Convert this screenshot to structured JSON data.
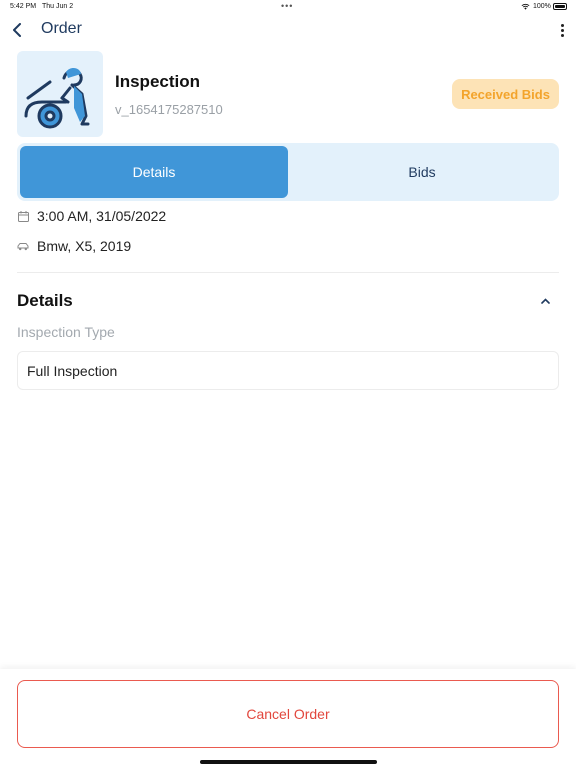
{
  "status_bar": {
    "time": "5:42 PM",
    "date": "Thu Jun 2",
    "battery": "100%"
  },
  "nav": {
    "title": "Order",
    "back_icon": "chevron-left-icon",
    "more_icon": "more-vertical-icon"
  },
  "order": {
    "service_name": "Inspection",
    "order_id": "v_1654175287510",
    "status": "Received Bids",
    "thumbnail_icon": "mechanic-car-icon"
  },
  "tabs": [
    {
      "label": "Details",
      "active": true
    },
    {
      "label": "Bids",
      "active": false
    }
  ],
  "info": {
    "datetime": "3:00 AM, 31/05/2022",
    "vehicle": "Bmw, X5, 2019"
  },
  "details_section": {
    "title": "Details",
    "fields": [
      {
        "label": "Inspection Type",
        "value": "Full Inspection"
      }
    ]
  },
  "actions": {
    "cancel_label": "Cancel Order"
  },
  "colors": {
    "accent": "#4096d8",
    "accent_light": "#e3f1fb",
    "badge_bg": "#fde3b6",
    "badge_text": "#f3a42c",
    "danger": "#e2473d",
    "title_navy": "#1f3a5f"
  }
}
